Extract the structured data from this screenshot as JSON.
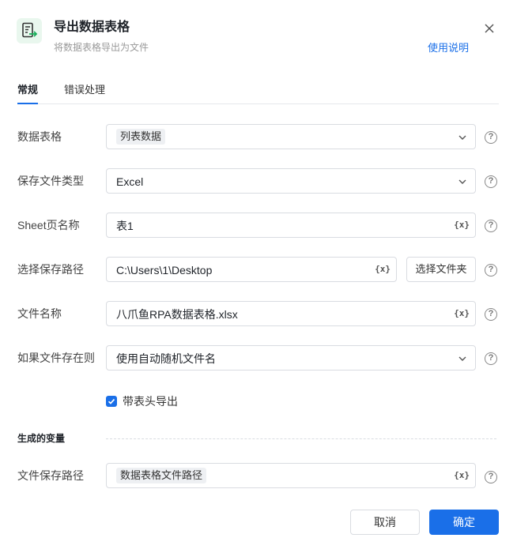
{
  "header": {
    "title": "导出数据表格",
    "subtitle": "将数据表格导出为文件",
    "help_link": "使用说明",
    "icon": "export-sheet-icon"
  },
  "tabs": [
    {
      "label": "常规",
      "active": true
    },
    {
      "label": "错误处理",
      "active": false
    }
  ],
  "form": {
    "data_table": {
      "label": "数据表格",
      "value": "列表数据"
    },
    "file_type": {
      "label": "保存文件类型",
      "value": "Excel"
    },
    "sheet_name": {
      "label": "Sheet页名称",
      "value": "表1"
    },
    "save_path": {
      "label": "选择保存路径",
      "value": "C:\\Users\\1\\Desktop",
      "button": "选择文件夹"
    },
    "file_name": {
      "label": "文件名称",
      "value": "八爪鱼RPA数据表格.xlsx"
    },
    "if_exists": {
      "label": "如果文件存在则",
      "value": "使用自动随机文件名"
    },
    "with_header": {
      "label": "带表头导出",
      "checked": true
    }
  },
  "output": {
    "section_title": "生成的变量",
    "saved_path": {
      "label": "文件保存路径",
      "value": "数据表格文件路径"
    }
  },
  "variable_symbol": "{x}",
  "help_symbol": "?",
  "footer": {
    "cancel": "取消",
    "confirm": "确定"
  },
  "colors": {
    "accent": "#1a6fe8",
    "icon_bg": "#e9f7ee",
    "icon_arrow": "#1aad5a"
  }
}
